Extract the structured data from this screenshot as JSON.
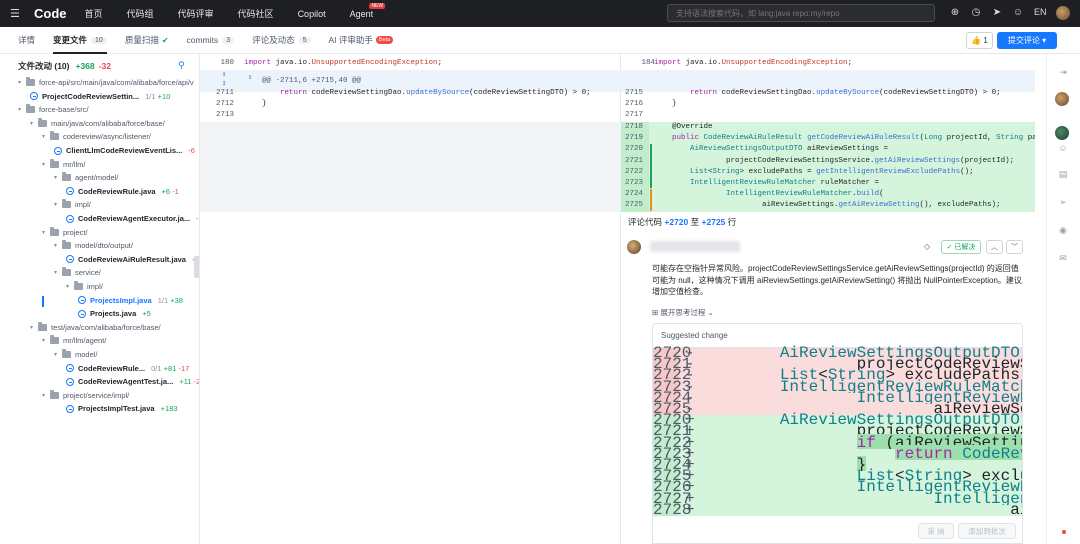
{
  "topnav": {
    "logo": "Code",
    "items": [
      "首页",
      "代码组",
      "代码评审",
      "代码社区",
      "Copilot",
      "Agent"
    ],
    "new_badge": "NEW",
    "search_placeholder": "支持语法搜索代码，如 lang:java repo:my/repo",
    "lang": "EN"
  },
  "tabs": [
    {
      "label": "详情"
    },
    {
      "label": "变更文件",
      "count": "10"
    },
    {
      "label": "质量扫描"
    },
    {
      "label": "commits",
      "count": "3"
    },
    {
      "label": "评论及动态",
      "count": "5"
    },
    {
      "label": "AI 评审助手",
      "badge": "Beta"
    }
  ],
  "actions": {
    "like_count": "1",
    "submit": "提交评论"
  },
  "tree": {
    "title": "文件改动 (10)",
    "add": "+368",
    "del": "-32",
    "rows": [
      {
        "type": "folder",
        "label": "force-api/src/main/java/com/alibaba/force/api/v"
      },
      {
        "type": "file",
        "label": "ProjectCodeReviewSettin...",
        "frac": "1/1",
        "add": "+10"
      },
      {
        "type": "folder",
        "label": "force-base/src/"
      },
      {
        "type": "folder",
        "label": "main/java/com/alibaba/force/base/"
      },
      {
        "type": "folder",
        "label": "codereview/async/listener/"
      },
      {
        "type": "file",
        "label": "ClientLlmCodeReviewEventLis...",
        "del": "-6"
      },
      {
        "type": "folder",
        "label": "mr/llm/"
      },
      {
        "type": "folder",
        "label": "agent/model/"
      },
      {
        "type": "file",
        "label": "CodeReviewRule.java",
        "add": "+6",
        "del": "-1"
      },
      {
        "type": "folder",
        "label": "impl/"
      },
      {
        "type": "file",
        "label": "CodeReviewAgentExecutor.ja...",
        "del": "-6"
      },
      {
        "type": "folder",
        "label": "project/"
      },
      {
        "type": "folder",
        "label": "model/dto/output/"
      },
      {
        "type": "file",
        "label": "CodeReviewAiRuleResult.java",
        "add": "+34"
      },
      {
        "type": "folder",
        "label": "service/"
      },
      {
        "type": "folder",
        "label": "impl/"
      },
      {
        "type": "file",
        "label": "ProjectsImpl.java",
        "frac": "1/1",
        "add": "+38",
        "selected": true
      },
      {
        "type": "file",
        "label": "Projects.java",
        "add": "+5"
      },
      {
        "type": "folder",
        "label": "test/java/com/alibaba/force/base/"
      },
      {
        "type": "folder",
        "label": "mr/llm/agent/"
      },
      {
        "type": "folder",
        "label": "model/"
      },
      {
        "type": "file",
        "label": "CodeReviewRule...",
        "frac": "0/1",
        "add": "+81",
        "del": "-17"
      },
      {
        "type": "file",
        "label": "CodeReviewAgentTest.ja...",
        "add": "+11",
        "del": "-2"
      },
      {
        "type": "folder",
        "label": "project/service/impl/"
      },
      {
        "type": "file",
        "label": "ProjectsImplTest.java",
        "add": "+183"
      }
    ]
  },
  "diff": {
    "top_left_ln": "180",
    "top_right_ln": "184",
    "top_code": "import java.io.UnsupportedEncodingException;",
    "hunk": "@@ -2711,6 +2715,40 @@",
    "left_lines": [
      {
        "ln": "2711",
        "code": "        return codeReviewSettingDao.updateBySource(codeReviewSettingDTO) > 0;"
      },
      {
        "ln": "2712",
        "code": "    }"
      },
      {
        "ln": "2713",
        "code": ""
      }
    ],
    "right_lines": [
      {
        "ln": "2715",
        "code": "        return codeReviewSettingDao.updateBySource(codeReviewSettingDTO) > 0;"
      },
      {
        "ln": "2716",
        "code": "    }"
      },
      {
        "ln": "2717",
        "code": ""
      }
    ],
    "added_lines": [
      {
        "ln": "2718",
        "code": "    @Override"
      },
      {
        "ln": "2719",
        "code": "    public CodeReviewAiRuleResult getCodeReviewAiRuleResult(Long projectId, String path) {"
      },
      {
        "ln": "2720",
        "code": "        AiReviewSettingsOutputDTO aiReviewSettings ="
      },
      {
        "ln": "2721",
        "code": "                projectCodeReviewSettingsService.getAiReviewSettings(projectId);"
      },
      {
        "ln": "2722",
        "code": "        List<String> excludePaths = getIntelligentReviewExcludePaths();"
      },
      {
        "ln": "2723",
        "code": "        IntelligentReviewRuleMatcher ruleMatcher ="
      },
      {
        "ln": "2724",
        "code": "                IntelligentReviewRuleMatcher.build("
      },
      {
        "ln": "2725",
        "code": "                        aiReviewSettings.getAiReviewSetting(), excludePaths);"
      }
    ]
  },
  "comment": {
    "range_prefix": "评论代码",
    "range_from": "+2720",
    "range_mid": "至",
    "range_to": "+2725",
    "range_suffix": "行",
    "resolved": "已解决",
    "body": "可能存在空指针异常风险。projectCodeReviewSettingsService.getAiReviewSettings(projectId) 的返回值可能为 null，这种情况下调用 aiReviewSettings.getAiReviewSetting() 将抛出 NullPointerException。建议增加空值检查。",
    "think": "展开思考过程",
    "suggested_title": "Suggested change",
    "suggested": [
      {
        "t": "del",
        "ln": "2720",
        "s": "-",
        "code": "        AiReviewSettingsOutputDTO aiReviewSettings ="
      },
      {
        "t": "del",
        "ln": "2721",
        "s": "-",
        "code": "                projectCodeReviewSettingsService.getAiReviewSettings(projectId);"
      },
      {
        "t": "del",
        "ln": "2722",
        "s": "-",
        "code": "        List<String> excludePaths = getIntelligentReviewExcludePaths();"
      },
      {
        "t": "del",
        "ln": "2723",
        "s": "-",
        "code": "        IntelligentReviewRuleMatcher ruleMatcher ="
      },
      {
        "t": "del",
        "ln": "2724",
        "s": "-",
        "code": "                IntelligentReviewRuleMatcher.build("
      },
      {
        "t": "del",
        "ln": "2725",
        "s": "-",
        "code": "                        aiReviewSettings.getAiReviewSetting(), excludePaths);"
      },
      {
        "t": "add",
        "ln": "2720",
        "s": "+",
        "code": "        AiReviewSettingsOutputDTO aiReviewSettings ="
      },
      {
        "t": "add",
        "ln": "2721",
        "s": "+",
        "code": "                projectCodeReviewSettingsService.getAiReviewSettings(proj"
      },
      {
        "t": "add",
        "ln": "2722",
        "s": "+",
        "code": "                if (aiReviewSettings == null) {",
        "hl": true
      },
      {
        "t": "add",
        "ln": "2723",
        "s": "+",
        "code": "                    return CodeReviewAiRuleResult.matchFailed(\"无法获取AI评审设置\");",
        "hl": true
      },
      {
        "t": "add",
        "ln": "2724",
        "s": "+",
        "code": "                }",
        "hl": true
      },
      {
        "t": "add",
        "ln": "2725",
        "s": "+",
        "code": "                List<String> excludePaths = getIntelligentReviewExcludePaths();"
      },
      {
        "t": "add",
        "ln": "2726",
        "s": "+",
        "code": "                IntelligentReviewRuleMatcher ruleMatcher ="
      },
      {
        "t": "add",
        "ln": "2727",
        "s": "+",
        "code": "                        IntelligentReviewRuleMatcher.build("
      },
      {
        "t": "add",
        "ln": "2728",
        "s": "+",
        "code": "                                aiReviewSettings.getAiReviewSetting(), excludePat"
      }
    ],
    "accept": "采 纳",
    "add_batch": "添加到批次"
  }
}
